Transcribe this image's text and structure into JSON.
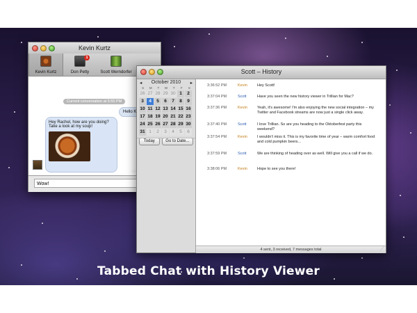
{
  "caption": "Tabbed Chat with History Viewer",
  "chat_window": {
    "title": "Kevin Kurtz",
    "tabs": [
      {
        "label": "Kevin Kurtz",
        "active": true,
        "icon": "avatar-soup-icon"
      },
      {
        "label": "Don Petty",
        "active": false,
        "badge": "1",
        "icon": "avatar-trillian-icon"
      },
      {
        "label": "Scott Werndorfer",
        "active": false,
        "icon": "avatar-bottle-icon"
      }
    ],
    "system_message": "Current conversation at 5:55 PM",
    "outgoing_message": "Hello Ki",
    "incoming_message": "Hey Rachel, how are you doing? Take a look at my soup!",
    "input_value": "Wow!"
  },
  "history_window": {
    "title": "Scott – History",
    "calendar": {
      "month": "October 2010",
      "prev": "◂",
      "next": "▸",
      "weekdays": [
        "S",
        "M",
        "T",
        "W",
        "T",
        "F",
        "S"
      ],
      "days": [
        {
          "d": "26",
          "dim": true
        },
        {
          "d": "27",
          "dim": true
        },
        {
          "d": "28",
          "dim": true
        },
        {
          "d": "29",
          "dim": true
        },
        {
          "d": "30",
          "dim": true
        },
        {
          "d": "1"
        },
        {
          "d": "2"
        },
        {
          "d": "3"
        },
        {
          "d": "4",
          "selected": true
        },
        {
          "d": "5"
        },
        {
          "d": "6"
        },
        {
          "d": "7"
        },
        {
          "d": "8"
        },
        {
          "d": "9"
        },
        {
          "d": "10"
        },
        {
          "d": "11"
        },
        {
          "d": "12"
        },
        {
          "d": "13"
        },
        {
          "d": "14"
        },
        {
          "d": "15"
        },
        {
          "d": "16"
        },
        {
          "d": "17"
        },
        {
          "d": "18"
        },
        {
          "d": "19"
        },
        {
          "d": "20"
        },
        {
          "d": "21"
        },
        {
          "d": "22"
        },
        {
          "d": "23"
        },
        {
          "d": "24"
        },
        {
          "d": "25"
        },
        {
          "d": "26"
        },
        {
          "d": "27"
        },
        {
          "d": "28"
        },
        {
          "d": "29"
        },
        {
          "d": "30"
        },
        {
          "d": "31"
        },
        {
          "d": "1",
          "dim": true
        },
        {
          "d": "2",
          "dim": true
        },
        {
          "d": "3",
          "dim": true
        },
        {
          "d": "4",
          "dim": true
        },
        {
          "d": "5",
          "dim": true
        },
        {
          "d": "6",
          "dim": true
        }
      ],
      "today_button": "Today",
      "goto_button": "Go to Date..."
    },
    "messages": [
      {
        "time": "3:36:52 PM",
        "sender": "Kevin",
        "text": "Hey Scott!"
      },
      {
        "time": "3:37:04 PM",
        "sender": "Scott",
        "text": "Have you seen the new history viewer in Trillian for Mac?"
      },
      {
        "time": "3:37:36 PM",
        "sender": "Kevin",
        "text": "Yeah, it's awesome! I'm also enjoying the new social integration – my Twitter and Facebook streams are now just a single click away."
      },
      {
        "time": "3:37:40 PM",
        "sender": "Scott",
        "text": "I love Trillian. So are you heading to the Oktoberfest party this weekend?"
      },
      {
        "time": "3:37:54 PM",
        "sender": "Kevin",
        "text": "I wouldn't miss it. This is my favorite time of year – warm comfort food and cold pumpkin beers..."
      },
      {
        "time": "3:37:59 PM",
        "sender": "Scott",
        "text": "We are thinking of heading over as well. Will give you a call if we do."
      },
      {
        "time": "3:38:06 PM",
        "sender": "Kevin",
        "text": "Hope to see you there!"
      }
    ],
    "status": "4 sent, 3 received, 7 messages total"
  },
  "colors": {
    "kevin": "#c27a12",
    "scott": "#2b5cb0",
    "selected_day": "#3f7ed6"
  }
}
